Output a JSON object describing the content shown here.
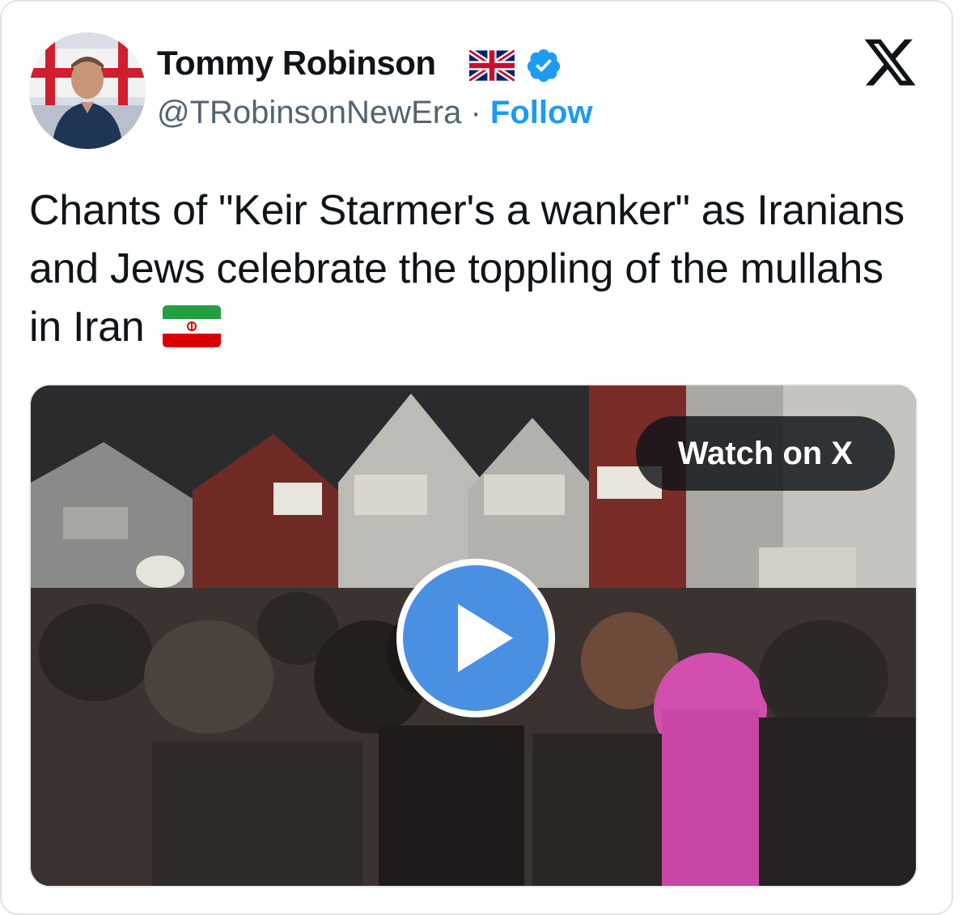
{
  "author": {
    "display_name": "Tommy Robinson",
    "handle": "@TRobinsonNewEra",
    "separator": "·",
    "follow_label": "Follow",
    "name_flag": "uk-flag-emoji",
    "verified_badge": "verified-badge-icon"
  },
  "brand": {
    "logo": "x-logo-icon"
  },
  "tweet": {
    "text": "Chants of \"Keir Starmer's a wanker\" as Iranians and Jews celebrate the toppling of the mullahs in Iran",
    "trailing_flag": "iran-flag-emoji"
  },
  "media": {
    "watch_label": "Watch on X",
    "play_icon": "play-icon"
  },
  "colors": {
    "accent": "#1d9bf0",
    "play_button": "#4a90e2",
    "text_primary": "#0f1419",
    "text_secondary": "#536471"
  }
}
